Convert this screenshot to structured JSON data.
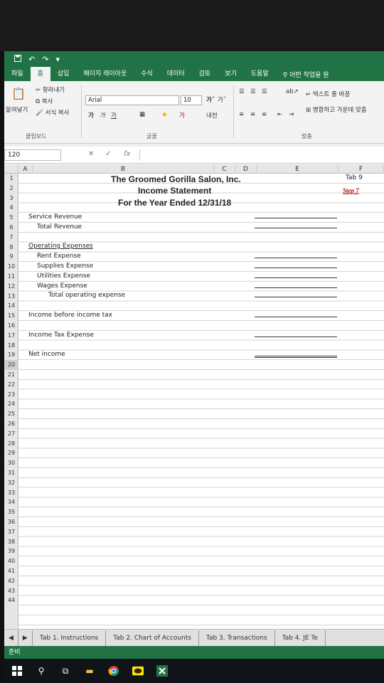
{
  "titlebar": {
    "save_icon": "save-icon",
    "undo": "↶",
    "redo": "↷",
    "qa_more": "▾"
  },
  "ribbon_tabs": [
    "파일",
    "홈",
    "삽입",
    "페이지 레이아웃",
    "수식",
    "데이터",
    "검토",
    "보기",
    "도움말"
  ],
  "tell_me": "어떤 작업을 원",
  "clipboard": {
    "paste": "붙여넣기",
    "cut": "잘라내기",
    "copy": "복사",
    "format_painter": "서식 복사",
    "group": "클립보드"
  },
  "font": {
    "name": "Arial",
    "size": "10",
    "group": "글꼴",
    "bold": "가",
    "italic": "가",
    "underline": "가"
  },
  "alignment": {
    "wrap": "텍스트 줄 바꿈",
    "merge": "병합하고 가운데 맞춤",
    "group": "맞춤"
  },
  "formula_bar": {
    "name_box": "120",
    "cancel": "✕",
    "enter": "✓",
    "fx": "fx"
  },
  "columns": [
    "A",
    "B",
    "C",
    "D",
    "E",
    "F"
  ],
  "rows": [
    "1",
    "2",
    "3",
    "4",
    "5",
    "6",
    "7",
    "8",
    "9",
    "10",
    "11",
    "12",
    "13",
    "14",
    "15",
    "16",
    "17",
    "18",
    "19",
    "20",
    "21",
    "22",
    "23",
    "24",
    "25",
    "26",
    "27",
    "28",
    "29",
    "30",
    "31",
    "32",
    "33",
    "34",
    "35",
    "36",
    "37",
    "38",
    "39",
    "40",
    "41",
    "42",
    "43",
    "44"
  ],
  "sheet": {
    "company": "The Groomed Gorilla Salon, Inc.",
    "statement": "Income Statement",
    "period": "For the Year Ended 12/31/18",
    "tab_label": "Tab 9",
    "step_label": "Step 7",
    "service_revenue": "Service Revenue",
    "total_revenue": "Total Revenue",
    "operating_expenses": "Operating Expenses",
    "rent_expense": "Rent Expense",
    "supplies_expense": "Supplies Expense",
    "utilities_expense": "Utilities Expense",
    "wages_expense": "Wages Expense",
    "total_operating": "Total operating expense",
    "income_before_tax": "Income before income tax",
    "income_tax": "Income Tax Expense",
    "net_income": "Net income"
  },
  "sheet_tabs": [
    "Tab 1. Instructions",
    "Tab 2. Chart of Accounts",
    "Tab 3. Transactions",
    "Tab 4. JE Te"
  ],
  "status": "준비",
  "colors": {
    "excel_green": "#217346",
    "step_red": "#c00000"
  }
}
